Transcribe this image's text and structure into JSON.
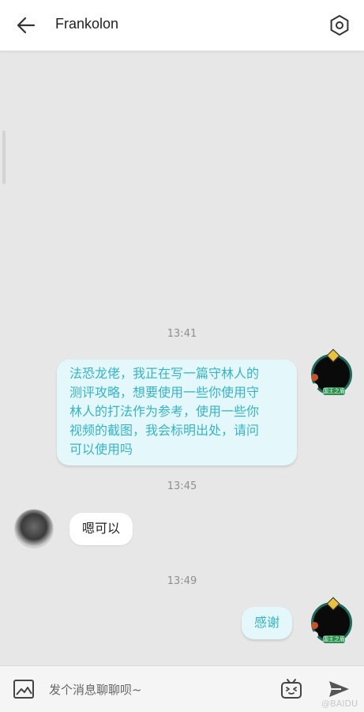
{
  "header": {
    "title": "Frankolon",
    "back_icon": "arrow-left-icon",
    "settings_icon": "hexagon-gear-icon"
  },
  "messages": [
    {
      "time": "13:41",
      "sender": "me",
      "text_lines": [
        "法恐龙佬，我正在写一篇守林人的",
        "测评攻略，想要使用一些你使用守",
        "林人的打法作为参考，使用一些你",
        "视频的截图，我会标明出处，请问",
        "可以使用吗"
      ]
    },
    {
      "time": "13:45",
      "sender": "other",
      "text": "嗯可以"
    },
    {
      "time": "13:49",
      "sender": "me",
      "text": "感谢"
    }
  ],
  "composer": {
    "placeholder": "发个消息聊聊呗~",
    "image_icon": "image-icon",
    "emoji_icon": "emoji-tv-icon",
    "send_icon": "send-icon"
  },
  "avatar_badge": "国王之盾",
  "watermark": "@BAIDU",
  "colors": {
    "background": "#e7e7e7",
    "my_bubble": "#e4f8fb",
    "my_text": "#37b3c7",
    "other_bubble": "#ffffff",
    "accent": "#1e6b5c"
  }
}
